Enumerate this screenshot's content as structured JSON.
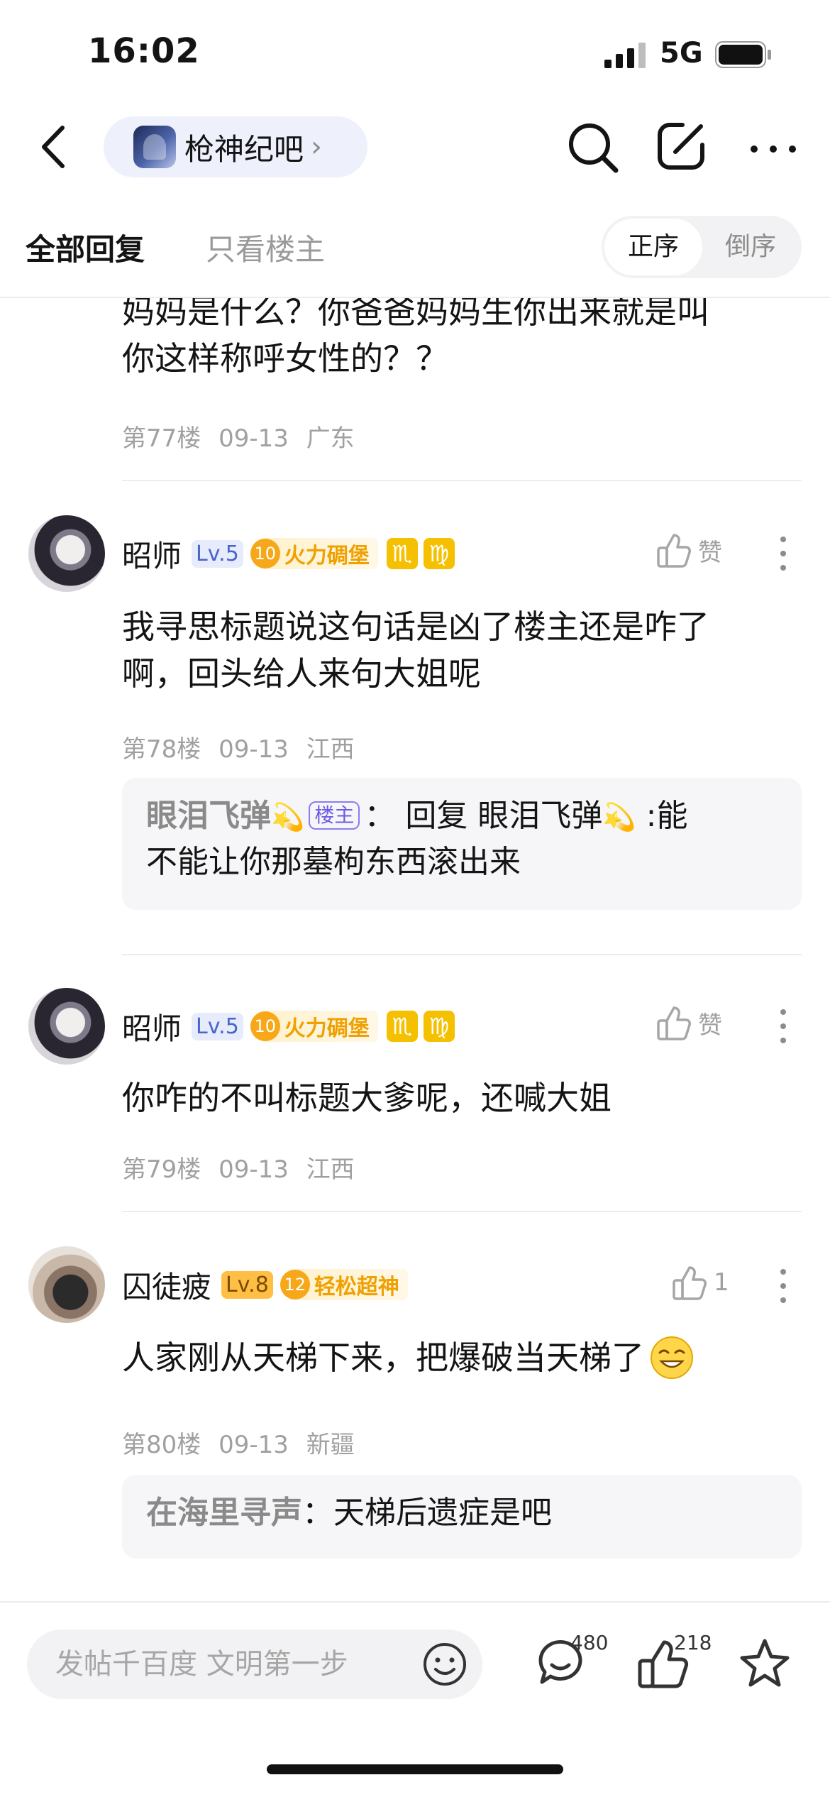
{
  "status_bar": {
    "time": "16:02",
    "network": "5G"
  },
  "nav": {
    "forum_name": "枪神纪吧",
    "chevron": "›"
  },
  "tabs": {
    "all_replies": "全部回复",
    "owner_only": "只看楼主",
    "sort_asc": "正序",
    "sort_desc": "倒序"
  },
  "top_post": {
    "text_line1": "妈妈是什么？你爸爸妈妈生你出来就是叫",
    "text_line2": "你这样称呼女性的？？",
    "floor": "第77楼",
    "date": "09-13",
    "location": "广东"
  },
  "posts": [
    {
      "username": "昭师",
      "level": "Lv.5",
      "badge_num": "10",
      "badge_text": "火力碉堡",
      "zodiac1": "♏",
      "zodiac2": "♍",
      "like_label": "赞",
      "text_line1": "我寻思标题说这句话是凶了楼主还是咋了",
      "text_line2": "啊，回头给人来句大姐呢",
      "floor": "第78楼",
      "date": "09-13",
      "location": "江西",
      "quote": {
        "author": "眼泪飞弹",
        "author_emoji": "💫",
        "owner_tag": "楼主",
        "prefix": "： 回复 ",
        "reply_to": "眼泪飞弹",
        "reply_emoji": "💫",
        "text_part1": " :能",
        "text_line2": "不能让你那墓枸东西滚出来"
      }
    },
    {
      "username": "昭师",
      "level": "Lv.5",
      "badge_num": "10",
      "badge_text": "火力碉堡",
      "zodiac1": "♏",
      "zodiac2": "♍",
      "like_label": "赞",
      "text_line1": "你咋的不叫标题大爹呢，还喊大姐",
      "floor": "第79楼",
      "date": "09-13",
      "location": "江西"
    },
    {
      "username": "囚徒疲",
      "level": "Lv.8",
      "badge_num": "12",
      "badge_text": "轻松超神",
      "like_count": "1",
      "text_line1": "人家刚从天梯下来，把爆破当天梯了",
      "floor": "第80楼",
      "date": "09-13",
      "location": "新疆",
      "quote": {
        "author": "在海里寻声",
        "text": "：天梯后遗症是吧"
      }
    }
  ],
  "bottom_bar": {
    "input_placeholder": "发帖千百度 文明第一步",
    "comment_count": "480",
    "like_count": "218"
  },
  "colors": {
    "accent": "#f5b400",
    "owner_tag": "#6c5ce7",
    "level_blue": "#4a63c9",
    "level_orange": "#ffbf44"
  }
}
